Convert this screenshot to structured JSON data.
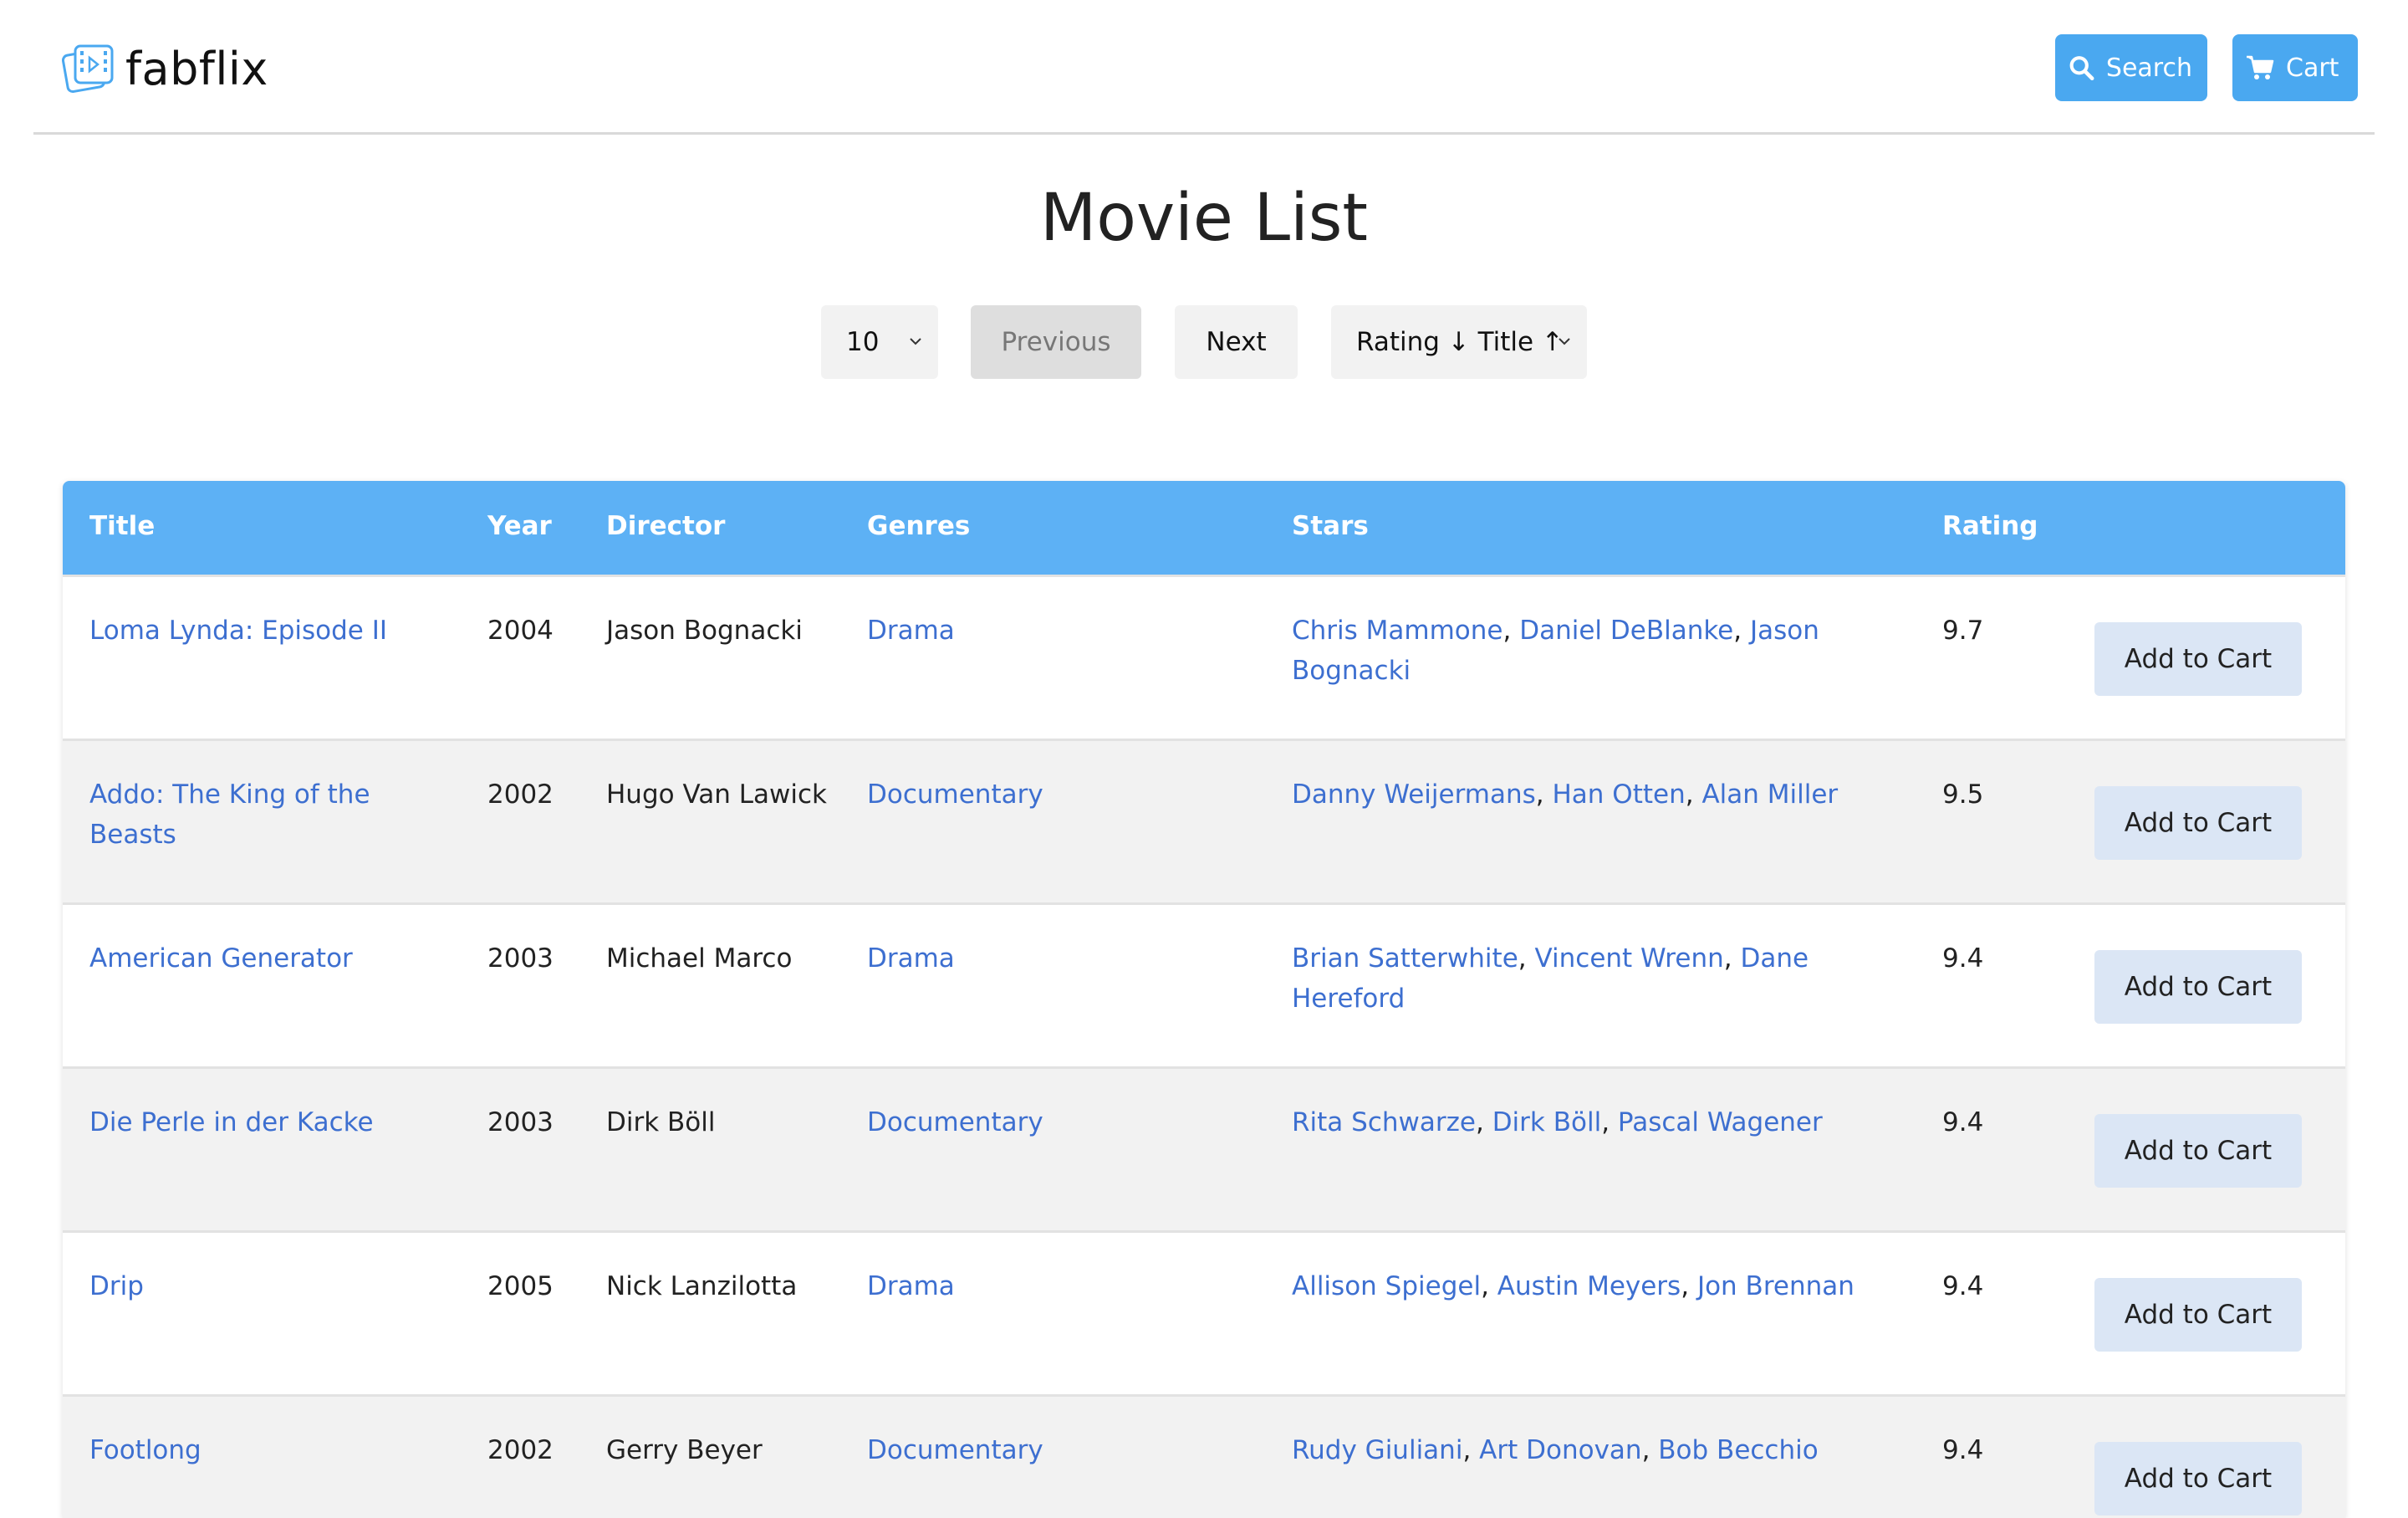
{
  "header": {
    "brand": "fabflix",
    "search_label": "Search",
    "cart_label": "Cart"
  },
  "page_title": "Movie List",
  "controls": {
    "page_size": "10",
    "previous_label": "Previous",
    "next_label": "Next",
    "sort_label": "Rating ↓ Title ↑"
  },
  "table": {
    "headers": {
      "title": "Title",
      "year": "Year",
      "director": "Director",
      "genres": "Genres",
      "stars": "Stars",
      "rating": "Rating"
    },
    "add_label": "Add to Cart",
    "rows": [
      {
        "title": "Loma Lynda: Episode II",
        "year": "2004",
        "director": "Jason Bognacki",
        "genre": "Drama",
        "stars": [
          "Chris Mammone",
          "Daniel DeBlanke",
          "Jason Bognacki"
        ],
        "rating": "9.7"
      },
      {
        "title": "Addo: The King of the Beasts",
        "year": "2002",
        "director": "Hugo Van Lawick",
        "genre": "Documentary",
        "stars": [
          "Danny Weijermans",
          "Han Otten",
          "Alan Miller"
        ],
        "rating": "9.5"
      },
      {
        "title": "American Generator",
        "year": "2003",
        "director": "Michael Marco",
        "genre": "Drama",
        "stars": [
          "Brian Satterwhite",
          "Vincent Wrenn",
          "Dane Hereford"
        ],
        "rating": "9.4"
      },
      {
        "title": "Die Perle in der Kacke",
        "year": "2003",
        "director": "Dirk Böll",
        "genre": "Documentary",
        "stars": [
          "Rita Schwarze",
          "Dirk Böll",
          "Pascal Wagener"
        ],
        "rating": "9.4"
      },
      {
        "title": "Drip",
        "year": "2005",
        "director": "Nick Lanzilotta",
        "genre": "Drama",
        "stars": [
          "Allison Spiegel",
          "Austin Meyers",
          "Jon Brennan"
        ],
        "rating": "9.4"
      },
      {
        "title": "Footlong",
        "year": "2002",
        "director": "Gerry Beyer",
        "genre": "Documentary",
        "stars": [
          "Rudy Giuliani",
          "Art Donovan",
          "Bob Becchio"
        ],
        "rating": "9.4"
      }
    ]
  }
}
